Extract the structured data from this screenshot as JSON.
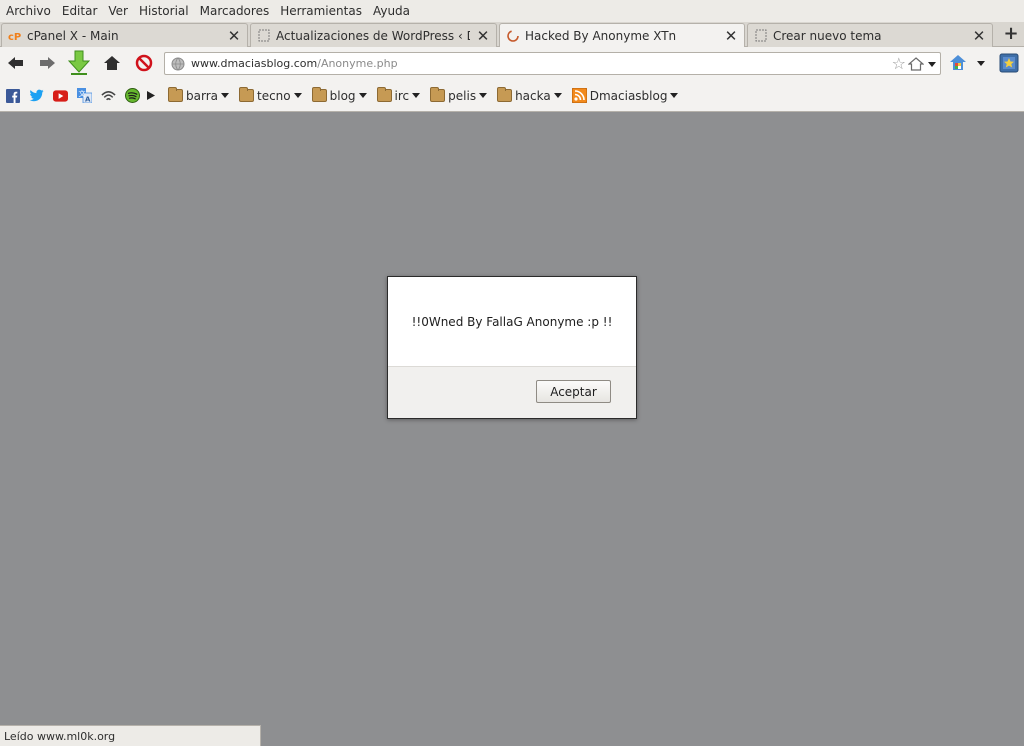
{
  "menu": {
    "items": [
      {
        "label": "Archivo"
      },
      {
        "label": "Editar"
      },
      {
        "label": "Ver"
      },
      {
        "label": "Historial"
      },
      {
        "label": "Marcadores"
      },
      {
        "label": "Herramientas"
      },
      {
        "label": "Ayuda"
      }
    ]
  },
  "tabs": [
    {
      "label": "cPanel X - Main",
      "icon": "cpanel-icon",
      "active": false
    },
    {
      "label": "Actualizaciones de WordPress ‹ Dmaci...",
      "icon": "page-icon",
      "active": false
    },
    {
      "label": "Hacked By Anonyme XTn",
      "icon": "loading-icon",
      "active": true
    },
    {
      "label": "Crear nuevo tema",
      "icon": "page-icon",
      "active": false
    }
  ],
  "navbar": {
    "url_domain": "www.dmaciasblog.com",
    "url_path": "/Anonyme.php"
  },
  "bookmarks": {
    "folders": [
      {
        "label": "barra"
      },
      {
        "label": "tecno"
      },
      {
        "label": "blog"
      },
      {
        "label": "irc"
      },
      {
        "label": "pelis"
      },
      {
        "label": "hacka"
      }
    ],
    "feed": {
      "label": "Dmaciasblog"
    }
  },
  "dialog": {
    "message": "!!0Wned By FallaG Anonyme :p !!",
    "ok_label": "Aceptar"
  },
  "status": {
    "text": "Leído www.ml0k.org"
  },
  "colors": {
    "content_bg": "#8e8f91",
    "chrome_bg": "#f3f2f0"
  }
}
